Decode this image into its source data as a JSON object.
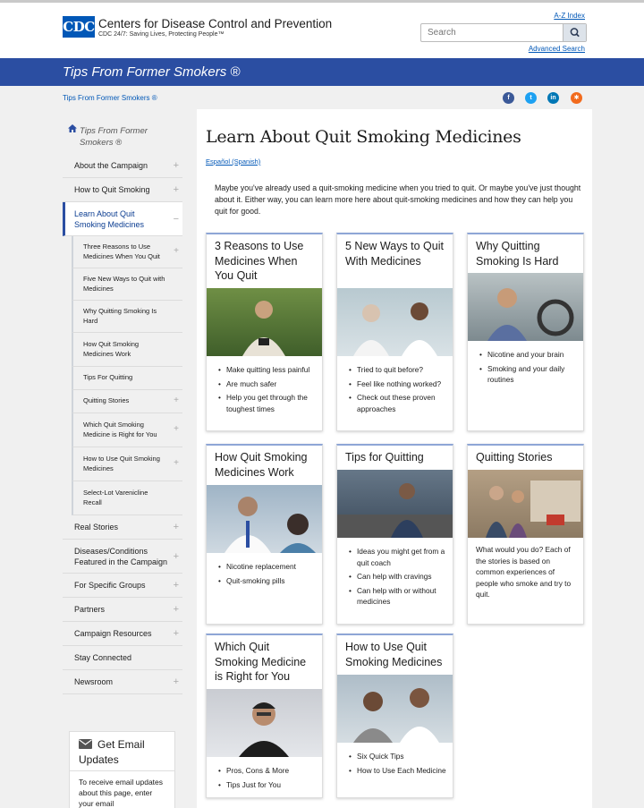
{
  "header": {
    "logo_text": "CDC",
    "title": "Centers for Disease Control and Prevention",
    "tagline": "CDC 24/7: Saving Lives, Protecting People™",
    "az_index": "A-Z Index",
    "search_placeholder": "Search",
    "advanced_search": "Advanced Search"
  },
  "banner": {
    "title": "Tips From Former Smokers ®"
  },
  "breadcrumb": {
    "label": "Tips From Former Smokers ®"
  },
  "social": [
    {
      "name": "facebook",
      "glyph": "f",
      "color": "#3b5998"
    },
    {
      "name": "twitter",
      "glyph": "t",
      "color": "#1da1f2"
    },
    {
      "name": "linkedin",
      "glyph": "in",
      "color": "#0077b5"
    },
    {
      "name": "syndicate",
      "glyph": "✱",
      "color": "#f26b1d"
    }
  ],
  "sidebar": {
    "home_label": "Tips From Former Smokers ®",
    "items": [
      {
        "label": "About the Campaign",
        "plus": true
      },
      {
        "label": "How to Quit Smoking",
        "plus": true
      },
      {
        "label": "Learn About Quit Smoking Medicines",
        "minus": true,
        "active": true
      },
      {
        "label": "Three Reasons to Use Medicines When You Quit",
        "plus": true,
        "sub": true
      },
      {
        "label": "Five New Ways to Quit with Medicines",
        "sub": true
      },
      {
        "label": "Why Quitting Smoking Is Hard",
        "sub": true
      },
      {
        "label": "How Quit Smoking Medicines Work",
        "sub": true
      },
      {
        "label": "Tips For Quitting",
        "sub": true
      },
      {
        "label": "Quitting Stories",
        "plus": true,
        "sub": true
      },
      {
        "label": "Which Quit Smoking Medicine is Right for You",
        "plus": true,
        "sub": true
      },
      {
        "label": "How to Use Quit Smoking Medicines",
        "plus": true,
        "sub": true
      },
      {
        "label": "Select-Lot Varenicline Recall",
        "sub": true
      },
      {
        "label": "Real Stories",
        "plus": true
      },
      {
        "label": "Diseases/Conditions Featured in the Campaign",
        "plus": true
      },
      {
        "label": "For Specific Groups",
        "plus": true
      },
      {
        "label": "Partners",
        "plus": true
      },
      {
        "label": "Campaign Resources",
        "plus": true
      },
      {
        "label": "Stay Connected"
      },
      {
        "label": "Newsroom",
        "plus": true
      }
    ],
    "email_title": "Get Email Updates",
    "email_text": "To receive email updates about this page, enter your email"
  },
  "main": {
    "title": "Learn About Quit Smoking Medicines",
    "spanish_link": "Español (Spanish)",
    "intro": "Maybe you've already used a quit-smoking medicine when you tried to quit. Or maybe you've just thought about it. Either way, you can learn more here about quit-smoking medicines and how they can help you quit for good."
  },
  "cards": [
    {
      "title": "3 Reasons to Use Medicines When You Quit",
      "image": "man-relaxing-in-grass",
      "bullets": [
        "Make quitting less painful",
        "Are much safer",
        "Help you get through the toughest times"
      ]
    },
    {
      "title": "5 New Ways to Quit With Medicines",
      "image": "pharmacist-with-patient",
      "bullets": [
        "Tried to quit before?",
        "Feel like nothing worked?",
        "Check out these proven approaches"
      ]
    },
    {
      "title": "Why Quitting Smoking Is Hard",
      "image": "man-driving-car",
      "bullets": [
        "Nicotine and your brain",
        "Smoking and your daily routines"
      ]
    },
    {
      "title": "How Quit Smoking Medicines Work",
      "image": "doctor-talking-to-patient",
      "bullets": [
        "Nicotine replacement",
        "Quit-smoking pills"
      ]
    },
    {
      "title": "Tips for Quitting",
      "image": "man-on-city-street",
      "bullets": [
        "Ideas you might get from a quit coach",
        "Can help with cravings",
        "Can help with or without medicines"
      ]
    },
    {
      "title": "Quitting Stories",
      "image": "family-house-for-sale",
      "text": "What would you do? Each of the stories is based on common experiences of people who smoke and try to quit."
    },
    {
      "title": "Which Quit Smoking Medicine is Right for You",
      "image": "woman-thinking",
      "bullets": [
        "Pros, Cons & More",
        "Tips Just for You"
      ]
    },
    {
      "title": "How to Use Quit Smoking Medicines",
      "image": "pharmacist-at-counter",
      "bullets": [
        "Six Quick Tips",
        "How to Use Each Medicine"
      ]
    }
  ]
}
